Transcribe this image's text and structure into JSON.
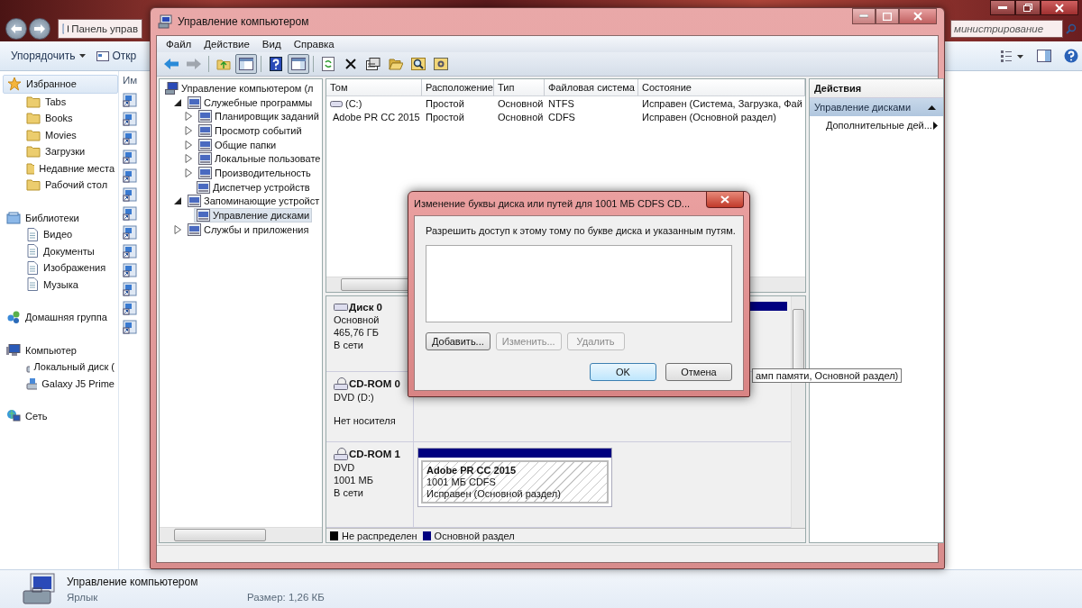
{
  "explorer": {
    "address_path": "Панель управ",
    "search": {
      "placeholder": "министрирование"
    },
    "toolbar": {
      "organize": "Упорядочить",
      "open": "Откр"
    },
    "column_header": "Им",
    "nav": [
      {
        "kind": "favorites",
        "label": "Избранное",
        "selected": true,
        "children": [
          {
            "label": "Tabs",
            "selected": false
          },
          {
            "label": "Books",
            "selected": false
          },
          {
            "label": "Movies",
            "selected": false
          },
          {
            "label": "Загрузки",
            "selected": false
          },
          {
            "label": "Недавние места",
            "selected": false
          },
          {
            "label": "Рабочий стол",
            "selected": false
          }
        ]
      },
      {
        "kind": "libraries",
        "label": "Библиотеки",
        "selected": false,
        "children": [
          {
            "label": "Видео",
            "selected": false
          },
          {
            "label": "Документы",
            "selected": false
          },
          {
            "label": "Изображения",
            "selected": false
          },
          {
            "label": "Музыка",
            "selected": false
          }
        ]
      },
      {
        "kind": "homegroup",
        "label": "Домашняя группа",
        "selected": false
      },
      {
        "kind": "computer",
        "label": "Компьютер",
        "selected": false,
        "children": [
          {
            "label": "Локальный диск (",
            "selected": false
          },
          {
            "label": "Galaxy J5 Prime",
            "selected": false
          }
        ]
      },
      {
        "kind": "network",
        "label": "Сеть",
        "selected": false
      }
    ],
    "details": {
      "name": "Управление компьютером",
      "type": "Ярлык",
      "size": "Размер: 1,26 КБ"
    }
  },
  "mmc": {
    "title": "Управление компьютером",
    "menu": [
      "Файл",
      "Действие",
      "Вид",
      "Справка"
    ],
    "toolbar": [
      {
        "kind": "back",
        "disabled": false,
        "pressed": false
      },
      {
        "kind": "forward",
        "disabled": true,
        "pressed": false
      },
      {
        "kind": "up",
        "disabled": false,
        "pressed": false
      },
      {
        "kind": "tree-toggle",
        "disabled": false,
        "pressed": true
      },
      {
        "kind": "help",
        "disabled": false,
        "pressed": false
      },
      {
        "kind": "actions-toggle",
        "disabled": false,
        "pressed": true
      },
      {
        "kind": "refresh",
        "disabled": false,
        "pressed": false
      },
      {
        "kind": "delete",
        "disabled": false,
        "pressed": false
      },
      {
        "kind": "properties",
        "disabled": false,
        "pressed": false
      },
      {
        "kind": "open",
        "disabled": false,
        "pressed": false
      },
      {
        "kind": "find",
        "disabled": false,
        "pressed": false
      },
      {
        "kind": "settings",
        "disabled": false,
        "pressed": false
      }
    ],
    "tree": [
      {
        "kind": "root",
        "label": "Управление компьютером (л",
        "selected": false,
        "children": [
          {
            "kind": "branch",
            "label": "Служебные программы",
            "expanded": true,
            "selected": false,
            "children": [
              {
                "kind": "branch",
                "label": "Планировщик заданий",
                "expanded": false,
                "selected": false
              },
              {
                "kind": "branch",
                "label": "Просмотр событий",
                "expanded": false,
                "selected": false
              },
              {
                "kind": "branch",
                "label": "Общие папки",
                "expanded": false,
                "selected": false
              },
              {
                "kind": "branch",
                "label": "Локальные пользовате",
                "expanded": false,
                "selected": false
              },
              {
                "kind": "branch",
                "label": "Производительность",
                "expanded": false,
                "selected": false
              },
              {
                "kind": "leaf",
                "label": "Диспетчер устройств",
                "selected": false
              }
            ]
          },
          {
            "kind": "branch",
            "label": "Запоминающие устройст",
            "expanded": true,
            "selected": false,
            "children": [
              {
                "kind": "leaf",
                "label": "Управление дисками",
                "selected": true
              }
            ]
          },
          {
            "kind": "branch",
            "label": "Службы и приложения",
            "expanded": false,
            "selected": false
          }
        ]
      }
    ],
    "volumes": {
      "columns": [
        "Том",
        "Расположение",
        "Тип",
        "Файловая система",
        "Состояние"
      ],
      "rows": [
        [
          "(C:)",
          "Простой",
          "Основной",
          "NTFS",
          "Исправен (Система, Загрузка, Фай"
        ],
        [
          "Adobe PR CC 2015",
          "Простой",
          "Основной",
          "CDFS",
          "Исправен (Основной раздел)"
        ]
      ]
    },
    "disks": [
      {
        "kind": "disk",
        "name": "Диск 0",
        "lines": [
          "Основной",
          "465,76 ГБ",
          "В сети"
        ]
      },
      {
        "kind": "cdrom",
        "name": "CD-ROM 0",
        "lines": [
          "DVD (D:)"
        ],
        "note": "Нет носителя"
      },
      {
        "kind": "cdrom",
        "name": "CD-ROM 1",
        "lines": [
          "DVD",
          "1001 МБ",
          "В сети"
        ],
        "partition": {
          "name": "Adobe PR CC 2015",
          "lines": [
            "1001 МБ CDFS",
            "Исправен (Основной раздел)"
          ]
        }
      }
    ],
    "tooltip": "амп памяти, Основной раздел)",
    "legend": [
      {
        "label": "Не распределен",
        "color": "#000000"
      },
      {
        "label": "Основной раздел",
        "color": "#000080"
      }
    ],
    "actions": {
      "title": "Действия",
      "sections": [
        {
          "label": "Управление дисками",
          "expanded": true,
          "items": [
            "Дополнительные дей..."
          ]
        }
      ]
    }
  },
  "dialog": {
    "title": "Изменение буквы диска или путей для 1001 МБ CDFS  CD...",
    "prompt": "Разрешить доступ к этому тому по букве диска и указанным путям.",
    "buttons": [
      {
        "label": "Добавить...",
        "disabled": false
      },
      {
        "label": "Изменить...",
        "disabled": true
      },
      {
        "label": "Удалить",
        "disabled": true
      }
    ],
    "ok": "OK",
    "cancel": "Отмена"
  }
}
